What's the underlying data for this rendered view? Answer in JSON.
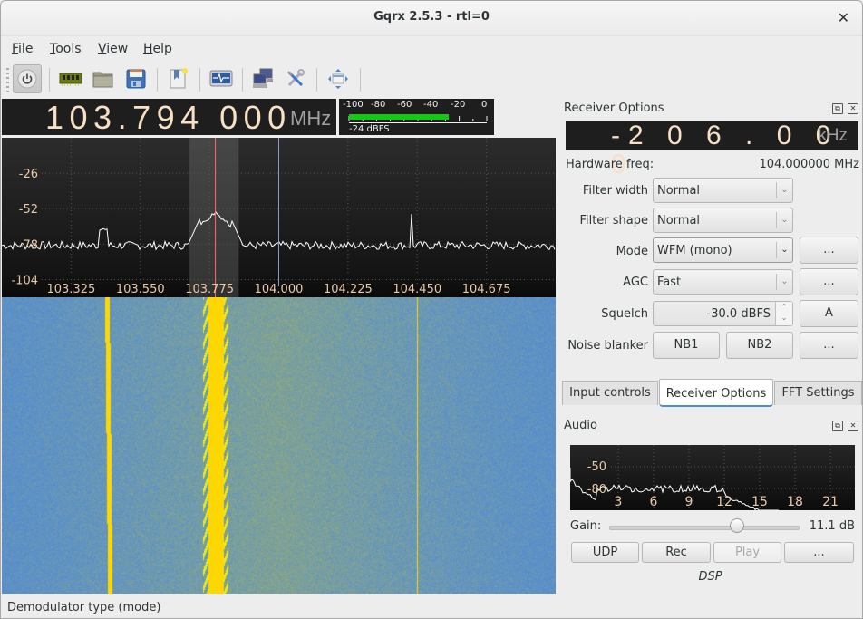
{
  "window": {
    "title": "Gqrx 2.5.3 - rtl=0",
    "close_icon": "close-icon"
  },
  "menu": [
    {
      "label": "File",
      "mnemonic": "F",
      "rest": "ile"
    },
    {
      "label": "Tools",
      "mnemonic": "T",
      "rest": "ools"
    },
    {
      "label": "View",
      "mnemonic": "V",
      "rest": "iew"
    },
    {
      "label": "Help",
      "mnemonic": "H",
      "rest": "elp"
    }
  ],
  "toolbar": {
    "buttons": [
      {
        "name": "power-button",
        "icon": "power-icon",
        "pressed": true
      },
      {
        "name": "io-devices-button",
        "icon": "circuit-board-icon"
      },
      {
        "name": "load-settings-button",
        "icon": "folder-icon"
      },
      {
        "name": "save-settings-button",
        "icon": "floppy-disk-icon"
      },
      {
        "name": "bookmarks-button",
        "icon": "bookmark-icon"
      },
      {
        "name": "dsp-button",
        "icon": "monitor-waveform-icon"
      },
      {
        "name": "remote-control-button",
        "icon": "network-computers-icon"
      },
      {
        "name": "configure-button",
        "icon": "tools-icon"
      },
      {
        "name": "fullscreen-button",
        "icon": "move-arrows-icon"
      }
    ]
  },
  "frequency": {
    "value": "103.794 000",
    "unit": "MHz"
  },
  "signal_meter": {
    "scale": [
      "-100",
      "-80",
      "-60",
      "-40",
      "-20",
      "0"
    ],
    "level_dbfs": -24,
    "readout": "-24 dBFS",
    "bar_color": "#14c814"
  },
  "fft_plot": {
    "y_labels": [
      "-26",
      "-52",
      "-78",
      "-104"
    ],
    "x_labels": [
      "103.325",
      "103.550",
      "103.775",
      "104.000",
      "104.225",
      "104.450",
      "104.675"
    ],
    "x_range_mhz": [
      103.1,
      104.9
    ],
    "y_range_db": [
      -117,
      0
    ],
    "demod_freq_mhz": 103.794,
    "center_freq_mhz": 104.0,
    "filter_band_mhz": [
      103.71,
      103.87
    ],
    "demod_line_color": "#ff6a6a",
    "center_line_color": "#8a9bc8"
  },
  "waterfall": {
    "colors": [
      "#4a84d8",
      "#8aaa70",
      "#f0f000",
      "#ffd800"
    ]
  },
  "status_bar": {
    "text": "Demodulator type (mode)"
  },
  "receiver_options": {
    "title": "Receiver Options",
    "offset": {
      "value": "-206.000",
      "display": "-2 0 6 . 0 0 0",
      "unit": "kHz"
    },
    "hardware_freq_label": "Hardware freq:",
    "hardware_freq_value": "104.000000 MHz",
    "filter_width": {
      "label": "Filter width",
      "value": "Normal"
    },
    "filter_shape": {
      "label": "Filter shape",
      "value": "Normal"
    },
    "mode": {
      "label": "Mode",
      "value": "WFM (mono)",
      "options_button": "..."
    },
    "agc": {
      "label": "AGC",
      "value": "Fast",
      "options_button": "..."
    },
    "squelch": {
      "label": "Squelch",
      "value": "-30.0 dBFS",
      "auto_button": "A"
    },
    "noise_blanker": {
      "label": "Noise blanker",
      "nb1": "NB1",
      "nb2": "NB2",
      "options_button": "..."
    }
  },
  "tabs": [
    {
      "label": "Input controls",
      "active": false
    },
    {
      "label": "Receiver Options",
      "active": true
    },
    {
      "label": "FFT Settings",
      "active": false
    }
  ],
  "audio": {
    "title": "Audio",
    "fft": {
      "y_labels": [
        "-50",
        "-80"
      ],
      "x_labels": [
        "3",
        "6",
        "9",
        "12",
        "15",
        "18",
        "21"
      ]
    },
    "gain_label": "Gain:",
    "gain_value": "11.1 dB",
    "gain_fraction": 0.68,
    "buttons": {
      "udp": "UDP",
      "rec": "Rec",
      "play": "Play",
      "more": "..."
    },
    "dsp_label": "DSP"
  }
}
